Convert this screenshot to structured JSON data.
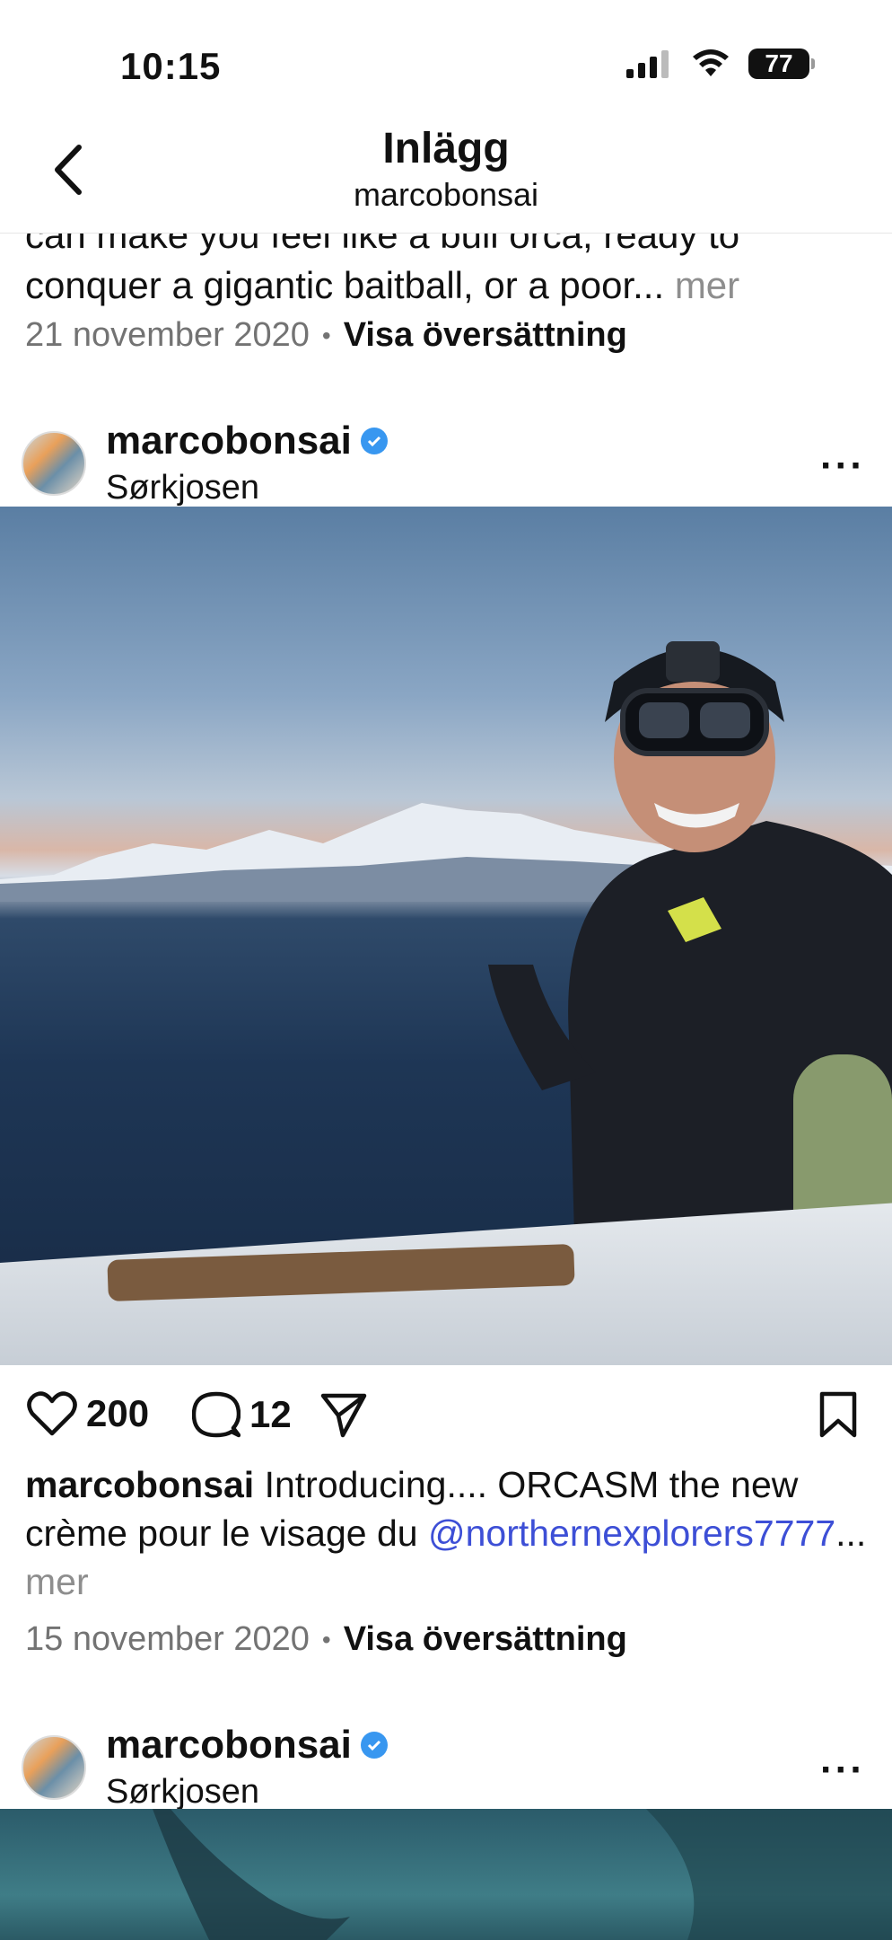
{
  "status_bar": {
    "time": "10:15",
    "battery": "77"
  },
  "header": {
    "title": "Inlägg",
    "subtitle": "marcobonsai"
  },
  "prev_post": {
    "caption_clipped_line": "can make you feel like a bull orca, ready to",
    "caption_line": "conquer a gigantic baitball, or a poor...",
    "more_label": "mer",
    "date": "21 november 2020",
    "translate_label": "Visa översättning"
  },
  "posts": [
    {
      "username": "marcobonsai",
      "location": "Sørkjosen",
      "likes": "200",
      "comments": "12",
      "caption_username": "marcobonsai",
      "caption_text": " Introducing.... ORCASM the new crème pour le visage du ",
      "caption_mention": "@northernexplorers7777",
      "caption_ellipsis": "...",
      "more_label": "mer",
      "date": "15 november 2020",
      "translate_label": "Visa översättning"
    },
    {
      "username": "marcobonsai",
      "location": "Sørkjosen"
    }
  ],
  "icons": {
    "back": "chevron-left-icon",
    "verified": "verified-badge-icon",
    "more": "more-horizontal-icon",
    "like": "heart-icon",
    "comment": "comment-icon",
    "share": "paper-plane-icon",
    "save": "bookmark-icon"
  },
  "colors": {
    "mention": "#3d4fd6",
    "verified": "#3897f0",
    "muted": "#737373"
  }
}
